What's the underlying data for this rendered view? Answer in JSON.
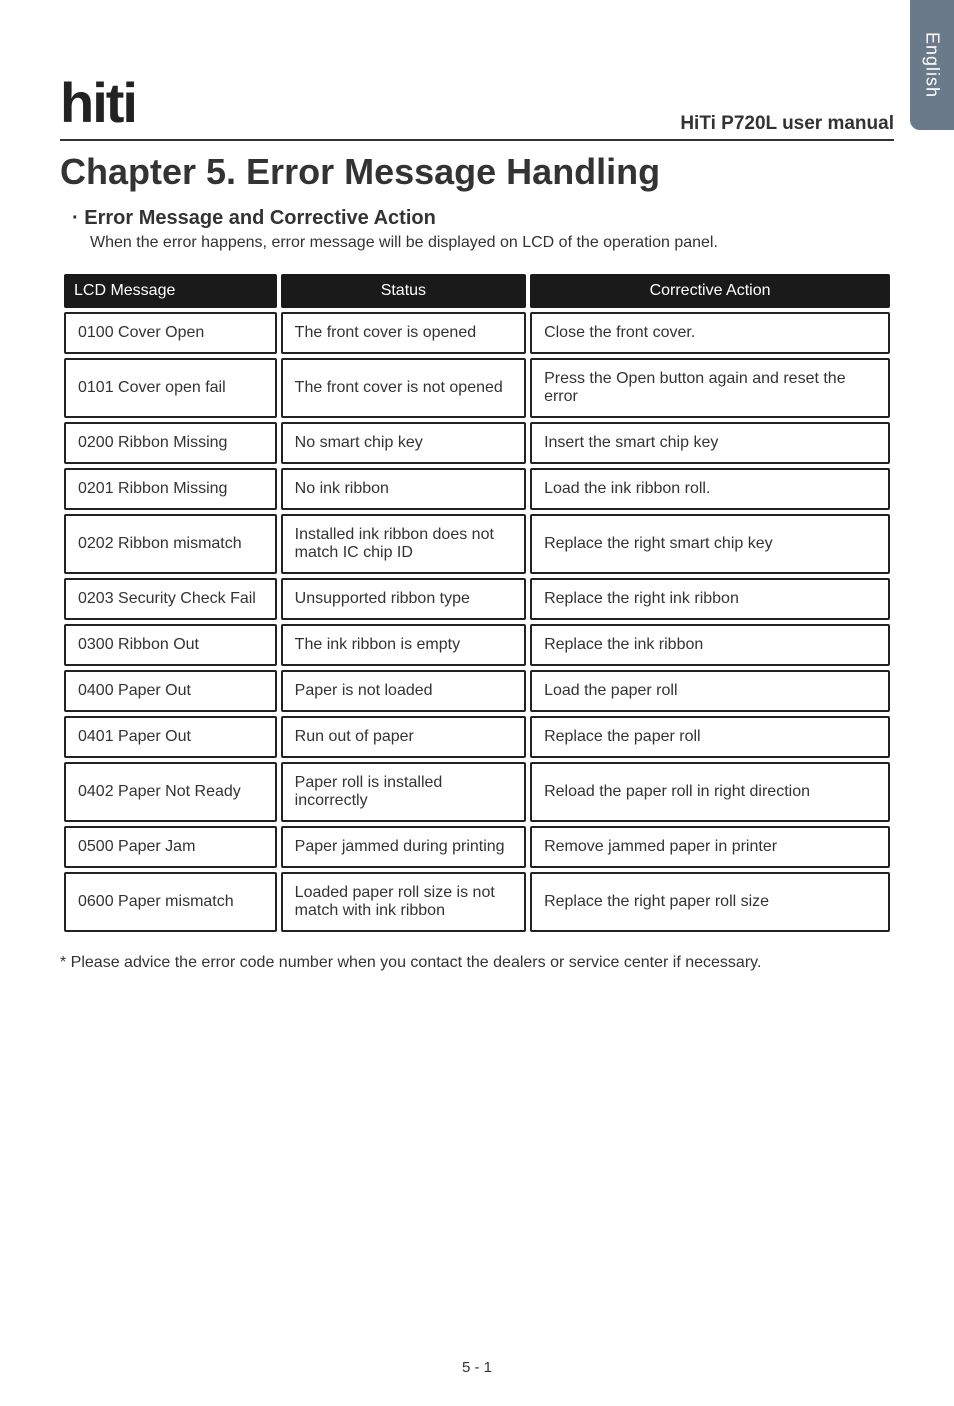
{
  "side_tab": "English",
  "header": {
    "logo": "hiti",
    "manual_title": "HiTi P720L user manual"
  },
  "chapter_title": "Chapter 5. Error Message Handling",
  "section": {
    "bullet": "·",
    "title": "Error Message and Corrective Action",
    "description": "When the error happens, error message will be displayed on LCD of the operation panel."
  },
  "table": {
    "headers": {
      "lcd": "LCD Message",
      "status": "Status",
      "action": "Corrective Action"
    },
    "rows": [
      {
        "lcd": "0100 Cover Open",
        "status": "The front cover is opened",
        "action": "Close the front cover."
      },
      {
        "lcd": "0101 Cover open fail",
        "status": "The front cover is not opened",
        "action": "Press the Open button again and reset the error"
      },
      {
        "lcd": "0200 Ribbon Missing",
        "status": "No smart chip key",
        "action": "Insert the smart chip key"
      },
      {
        "lcd": "0201 Ribbon Missing",
        "status": "No ink ribbon",
        "action": "Load the ink ribbon roll."
      },
      {
        "lcd": "0202 Ribbon mismatch",
        "status": "Installed ink ribbon does not match IC chip ID",
        "action": "Replace the right smart chip key"
      },
      {
        "lcd": "0203 Security Check Fail",
        "status": "Unsupported ribbon type",
        "action": "Replace the right ink ribbon"
      },
      {
        "lcd": "0300 Ribbon Out",
        "status": "The ink ribbon is empty",
        "action": "Replace the ink ribbon"
      },
      {
        "lcd": "0400 Paper Out",
        "status": "Paper is not loaded",
        "action": "Load the paper roll"
      },
      {
        "lcd": "0401 Paper Out",
        "status": "Run out of paper",
        "action": "Replace the paper roll"
      },
      {
        "lcd": "0402 Paper Not Ready",
        "status": "Paper roll is installed incorrectly",
        "action": "Reload the paper roll in right direction"
      },
      {
        "lcd": "0500 Paper Jam",
        "status": "Paper jammed during printing",
        "action": "Remove jammed paper in printer"
      },
      {
        "lcd": "0600 Paper mismatch",
        "status": "Loaded paper roll size is not match with ink ribbon",
        "action": "Replace the right paper roll size"
      }
    ]
  },
  "footnote": "* Please advice the error code number when you contact the dealers or service center if necessary.",
  "page_number": "5 - 1"
}
